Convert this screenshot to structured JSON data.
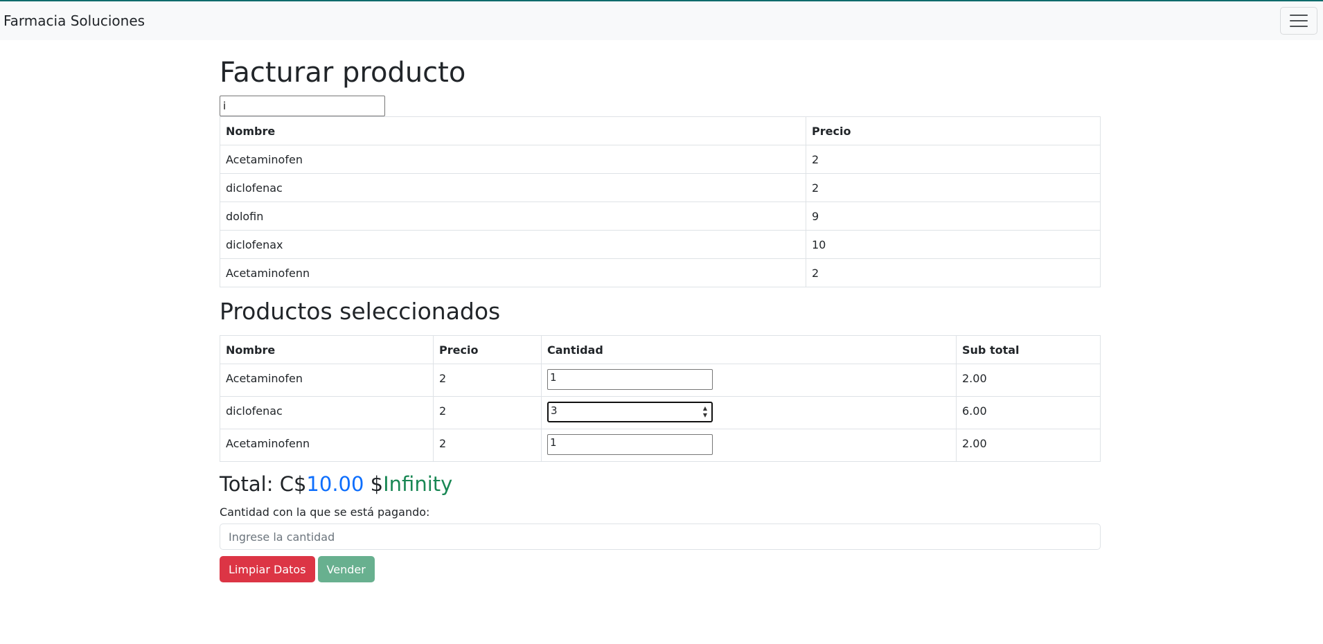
{
  "navbar": {
    "brand": "Farmacia Soluciones",
    "toggler_icon": "hamburger-icon"
  },
  "page": {
    "title": "Facturar producto"
  },
  "search": {
    "value": "i"
  },
  "products_table": {
    "headers": [
      "Nombre",
      "Precio"
    ],
    "rows": [
      {
        "name": "Acetaminofen",
        "price": "2"
      },
      {
        "name": "diclofenac",
        "price": "2"
      },
      {
        "name": "dolofin",
        "price": "9"
      },
      {
        "name": "diclofenax",
        "price": "10"
      },
      {
        "name": "Acetaminofenn",
        "price": "2"
      }
    ]
  },
  "selected": {
    "title": "Productos seleccionados",
    "headers": [
      "Nombre",
      "Precio",
      "Cantidad",
      "Sub total"
    ],
    "rows": [
      {
        "name": "Acetaminofen",
        "price": "2",
        "qty": "1",
        "subtotal": "2.00"
      },
      {
        "name": "diclofenac",
        "price": "2",
        "qty": "3",
        "subtotal": "6.00"
      },
      {
        "name": "Acetaminofenn",
        "price": "2",
        "qty": "1",
        "subtotal": "2.00"
      }
    ]
  },
  "total": {
    "label": "Total: C$",
    "cordobas": "10.00",
    "usd_symbol": "$",
    "usd": "Infinity"
  },
  "payment": {
    "label": "Cantidad con la que se está pagando:",
    "placeholder": "Ingrese la cantidad"
  },
  "buttons": {
    "clear": "Limpiar Datos",
    "sell": "Vender"
  },
  "colors": {
    "danger": "#dc3545",
    "success": "#198754",
    "primary": "#0d6efd"
  }
}
